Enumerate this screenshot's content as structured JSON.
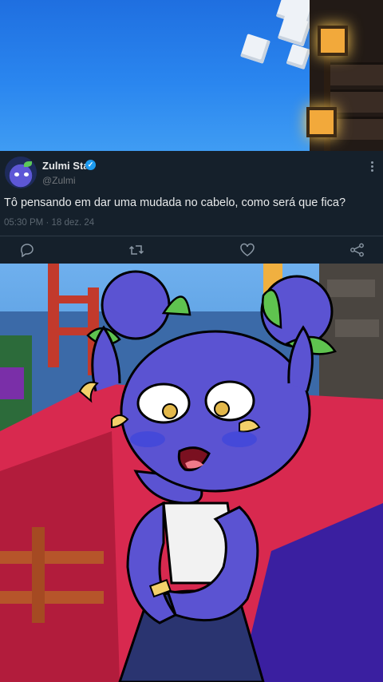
{
  "tweet": {
    "display_name": "Zulmi Star",
    "handle": "@Zulmi",
    "text": "Tô pensando em dar uma mudada no cabelo, como será que fica?",
    "time": "05:30 PM",
    "separator": "·",
    "date": "18 dez. 24",
    "icons": {
      "verified": "verified-badge-icon",
      "more": "more-vertical-icon",
      "reply": "reply-icon",
      "retweet": "retweet-icon",
      "like": "heart-icon",
      "share": "share-icon"
    }
  },
  "colors": {
    "card_background": "#15202b",
    "primary_text": "#e7e9ea",
    "secondary_text": "#71767b",
    "verified_blue": "#1d9bf0"
  }
}
